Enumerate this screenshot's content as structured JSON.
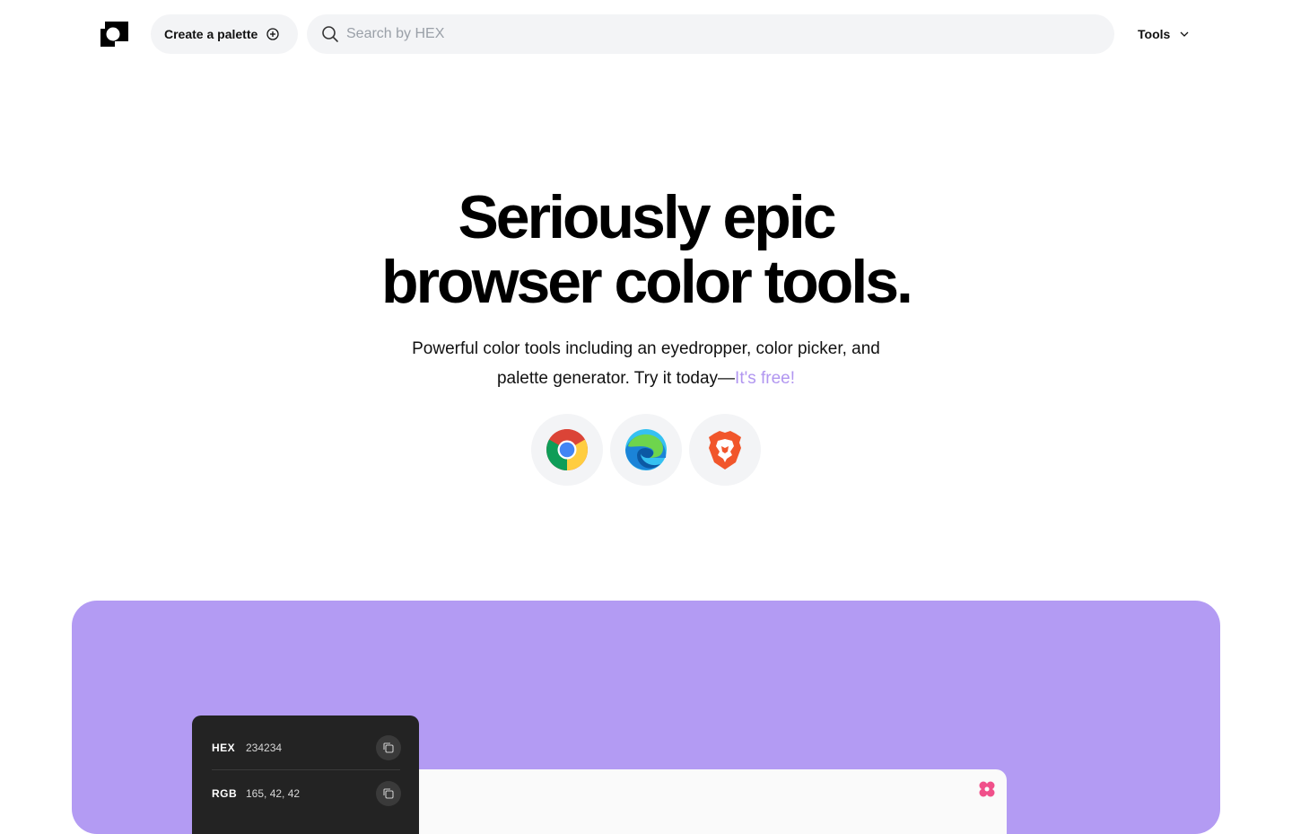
{
  "header": {
    "create_label": "Create a palette",
    "search_placeholder": "Search by HEX",
    "tools_label": "Tools"
  },
  "hero": {
    "title_line1": "Seriously epic",
    "title_line2": "browser color tools.",
    "subtitle_line1": "Powerful color tools including an eyedropper, color picker, and",
    "subtitle_line2": "palette generator. Try it today—",
    "free_label": "It's free!"
  },
  "browsers": [
    {
      "icon": "chrome-icon"
    },
    {
      "icon": "edge-icon"
    },
    {
      "icon": "brave-icon"
    }
  ],
  "showcase": {
    "background": "#b39bf3",
    "rows": [
      {
        "label": "HEX",
        "value": "234234"
      },
      {
        "label": "RGB",
        "value": "165, 42, 42"
      }
    ]
  },
  "colors": {
    "accent": "#b196f0",
    "chip_bg": "#f3f4f6"
  }
}
